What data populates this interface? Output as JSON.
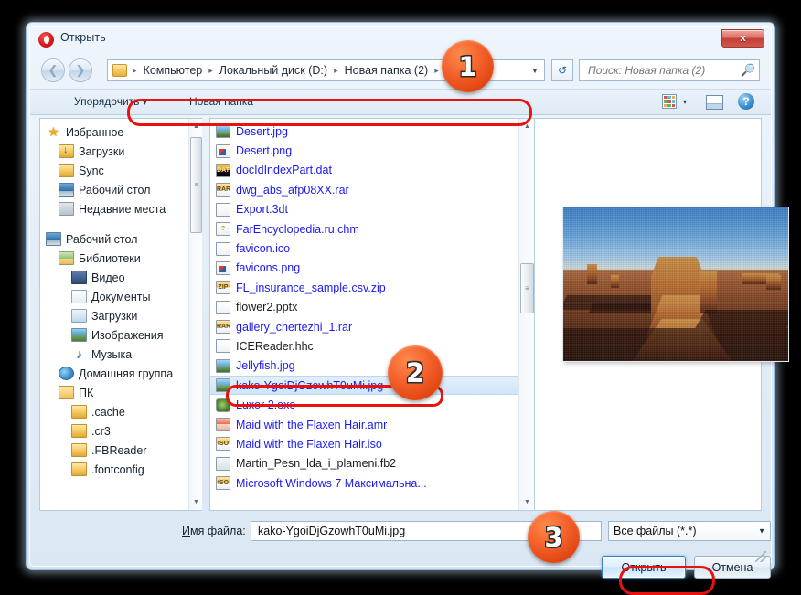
{
  "window": {
    "title": "Открыть",
    "app_icon": "opera-icon",
    "close_label": "x"
  },
  "nav": {
    "back_icon": "arrow-left-icon",
    "forward_icon": "arrow-right-icon",
    "breadcrumbs": [
      "Компьютер",
      "Локальный диск (D:)",
      "Новая папка (2)"
    ],
    "separator": "▸",
    "dropdown_icon": "chevron-down-icon",
    "refresh_icon": "refresh-icon"
  },
  "search": {
    "placeholder": "Поиск: Новая папка (2)",
    "value": "",
    "icon": "search-icon"
  },
  "toolbar": {
    "organize_label": "Упорядочить",
    "organize_caret": "▾",
    "new_folder_label": "Новая папка",
    "views_icon": "view-grid-icon",
    "views_caret": "▾",
    "pane_icon": "preview-pane-icon",
    "help_icon": "help-icon",
    "help_label": "?"
  },
  "sidebar": {
    "groups": [
      {
        "items": [
          {
            "label": "Избранное",
            "icon": "star-icon",
            "indent": 0,
            "icon_class": "ico-star",
            "glyph": "★"
          },
          {
            "label": "Загрузки",
            "icon": "downloads-folder-icon",
            "indent": 1,
            "icon_class": "ico-dl",
            "glyph": ""
          },
          {
            "label": "Sync",
            "icon": "folder-icon",
            "indent": 1,
            "icon_class": "ico-folder",
            "glyph": ""
          },
          {
            "label": "Рабочий стол",
            "icon": "desktop-icon",
            "indent": 1,
            "icon_class": "ico-desktop",
            "glyph": ""
          },
          {
            "label": "Недавние места",
            "icon": "recent-places-icon",
            "indent": 1,
            "icon_class": "ico-recent",
            "glyph": ""
          }
        ]
      },
      {
        "items": [
          {
            "label": "Рабочий стол",
            "icon": "desktop-icon",
            "indent": 0,
            "icon_class": "ico-desktop",
            "glyph": ""
          },
          {
            "label": "Библиотеки",
            "icon": "libraries-icon",
            "indent": 1,
            "icon_class": "ico-library",
            "glyph": ""
          },
          {
            "label": "Видео",
            "icon": "video-library-icon",
            "indent": 2,
            "icon_class": "ico-video",
            "glyph": ""
          },
          {
            "label": "Документы",
            "icon": "documents-library-icon",
            "indent": 2,
            "icon_class": "ico-doc",
            "glyph": ""
          },
          {
            "label": "Загрузки",
            "icon": "downloads-library-icon",
            "indent": 2,
            "icon_class": "ico-dlfold",
            "glyph": ""
          },
          {
            "label": "Изображения",
            "icon": "pictures-library-icon",
            "indent": 2,
            "icon_class": "ico-pic",
            "glyph": ""
          },
          {
            "label": "Музыка",
            "icon": "music-library-icon",
            "indent": 2,
            "icon_class": "ico-music",
            "glyph": "♪"
          },
          {
            "label": "Домашняя группа",
            "icon": "homegroup-icon",
            "indent": 1,
            "icon_class": "ico-home",
            "glyph": ""
          },
          {
            "label": "ПК",
            "icon": "user-folder-icon",
            "indent": 1,
            "icon_class": "ico-pc",
            "glyph": ""
          },
          {
            "label": ".cache",
            "icon": "folder-icon",
            "indent": 2,
            "icon_class": "ico-folder",
            "glyph": ""
          },
          {
            "label": ".cr3",
            "icon": "folder-icon",
            "indent": 2,
            "icon_class": "ico-folder",
            "glyph": ""
          },
          {
            "label": ".FBReader",
            "icon": "folder-icon",
            "indent": 2,
            "icon_class": "ico-folder",
            "glyph": ""
          },
          {
            "label": ".fontconfig",
            "icon": "folder-icon",
            "indent": 2,
            "icon_class": "ico-folder",
            "glyph": ""
          }
        ]
      }
    ],
    "scroll_up_icon": "scroll-up-icon",
    "scroll_down_icon": "scroll-down-icon"
  },
  "files": [
    {
      "name": "Desert.jpg",
      "icon": "image-file-icon",
      "icon_class": "fi-img",
      "glyph": "",
      "dark": false,
      "selected": false
    },
    {
      "name": "Desert.png",
      "icon": "png-file-icon",
      "icon_class": "fi-png",
      "glyph": "",
      "dark": false,
      "selected": false
    },
    {
      "name": "docIdIndexPart.dat",
      "icon": "dat-file-icon",
      "icon_class": "fi-dat",
      "glyph": "DAT",
      "dark": false,
      "selected": false
    },
    {
      "name": "dwg_abs_afp08XX.rar",
      "icon": "rar-archive-icon",
      "icon_class": "fi-rar",
      "glyph": "RAR",
      "dark": false,
      "selected": false
    },
    {
      "name": "Export.3dt",
      "icon": "generic-file-icon",
      "icon_class": "fi-blank",
      "glyph": "",
      "dark": false,
      "selected": false
    },
    {
      "name": "FarEncyclopedia.ru.chm",
      "icon": "chm-help-file-icon",
      "icon_class": "fi-chm",
      "glyph": "?",
      "dark": false,
      "selected": false
    },
    {
      "name": "favicon.ico",
      "icon": "generic-file-icon",
      "icon_class": "fi-blank",
      "glyph": "",
      "dark": false,
      "selected": false
    },
    {
      "name": "favicons.png",
      "icon": "png-file-icon",
      "icon_class": "fi-png",
      "glyph": "",
      "dark": false,
      "selected": false
    },
    {
      "name": "FL_insurance_sample.csv.zip",
      "icon": "zip-archive-icon",
      "icon_class": "fi-zip",
      "glyph": "ZIP",
      "dark": false,
      "selected": false
    },
    {
      "name": "flower2.pptx",
      "icon": "generic-file-icon",
      "icon_class": "fi-blank",
      "glyph": "",
      "dark": true,
      "selected": false
    },
    {
      "name": "gallery_chertezhi_1.rar",
      "icon": "rar-archive-icon",
      "icon_class": "fi-rar",
      "glyph": "RAR",
      "dark": false,
      "selected": false
    },
    {
      "name": "ICEReader.hhc",
      "icon": "generic-file-icon",
      "icon_class": "fi-blank",
      "glyph": "",
      "dark": true,
      "selected": false
    },
    {
      "name": "Jellyfish.jpg",
      "icon": "image-file-icon",
      "icon_class": "fi-img",
      "glyph": "",
      "dark": false,
      "selected": false
    },
    {
      "name": "kako-YgoiDjGzowhT0uMi.jpg",
      "icon": "image-file-icon",
      "icon_class": "fi-img",
      "glyph": "",
      "dark": false,
      "selected": true
    },
    {
      "name": "Luxor 2.exe",
      "icon": "exe-application-icon",
      "icon_class": "fi-exe",
      "glyph": "",
      "dark": false,
      "selected": false
    },
    {
      "name": "Maid with the Flaxen Hair.amr",
      "icon": "amr-audio-icon",
      "icon_class": "fi-amr",
      "glyph": "",
      "dark": false,
      "selected": false
    },
    {
      "name": "Maid with the Flaxen Hair.iso",
      "icon": "iso-image-icon",
      "icon_class": "fi-iso",
      "glyph": "ISO",
      "dark": false,
      "selected": false
    },
    {
      "name": "Martin_Pesn_lda_i_plameni.fb2",
      "icon": "fb2-ebook-icon",
      "icon_class": "fi-fb2",
      "glyph": "",
      "dark": true,
      "selected": false
    },
    {
      "name": "Microsoft Windows 7 Максимальна...",
      "icon": "iso-image-icon",
      "icon_class": "fi-iso",
      "glyph": "ISO",
      "dark": false,
      "selected": false
    }
  ],
  "filelist_scroll": {
    "up_icon": "scroll-up-icon",
    "down_icon": "scroll-down-icon",
    "thumb_grip": "≡"
  },
  "preview": {
    "image_alt": "desert-mesa-photo-preview",
    "file": "kako-YgoiDjGzowhT0uMi.jpg"
  },
  "form": {
    "filename_label_prefix": "И",
    "filename_label_rest": "мя файла:",
    "filename_value": "kako-YgoiDjGzowhT0uMi.jpg",
    "filetype_value": "Все файлы (*.*)",
    "filetype_caret": "▼",
    "open_button": "Открыть",
    "cancel_button": "Отмена"
  },
  "annotations": {
    "highlight_color": "#e8130e",
    "badge_color": "#f4612a",
    "badges": [
      {
        "number": "1",
        "target": "address-bar"
      },
      {
        "number": "2",
        "target": "selected-file-row"
      },
      {
        "number": "3",
        "target": "open-button"
      }
    ]
  }
}
